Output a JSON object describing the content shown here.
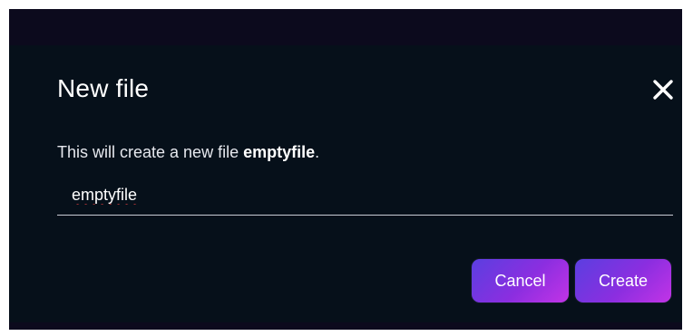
{
  "dialog": {
    "title": "New file",
    "description_prefix": "This will create a new file ",
    "description_filename": "emptyfile",
    "description_suffix": ".",
    "input_value": "emptyfile",
    "close_icon": "close-icon"
  },
  "actions": {
    "cancel_label": "Cancel",
    "create_label": "Create"
  },
  "colors": {
    "dialog_background": "#06101a",
    "backdrop": "#0c0a1d",
    "button_gradient_start": "#5b3fe0",
    "button_gradient_end": "#c234e6",
    "text": "#ffffff"
  }
}
